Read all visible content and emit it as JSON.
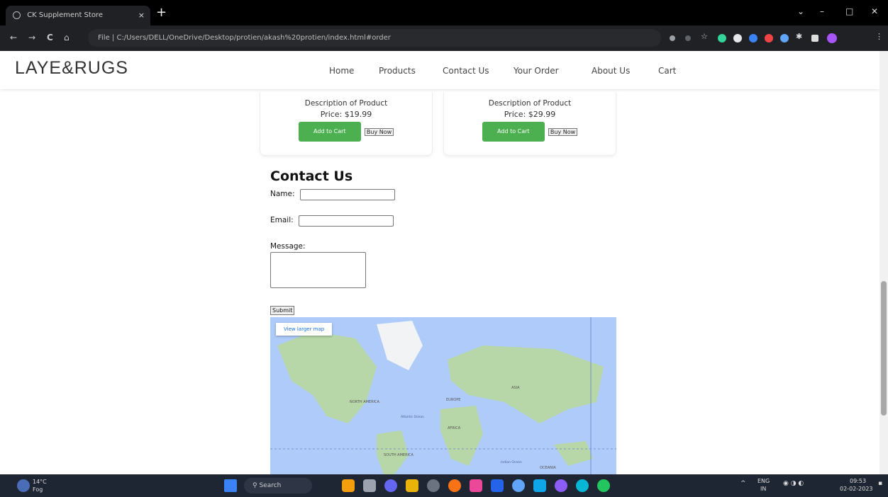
{
  "browser": {
    "tab_title": "CK Supplement Store",
    "tab_close": "×",
    "new_tab": "+",
    "address": "File | C:/Users/DELL/OneDrive/Desktop/protien/akash%20protien/index.html#order",
    "nav": {
      "back": "←",
      "forward": "→",
      "reload": "C",
      "home": "⌂"
    },
    "window": {
      "min": "–",
      "max": "□",
      "close": "✕"
    }
  },
  "site": {
    "logo": "LAYE&RUGS",
    "nav": [
      "Home",
      "Products",
      "Contact Us",
      "Your Order",
      "About Us",
      "Cart"
    ],
    "products": [
      {
        "description": "Description of Product",
        "price": "Price: $19.99",
        "add_label": "Add to Cart",
        "buy_label": "Buy Now"
      },
      {
        "description": "Description of Product",
        "price": "Price: $29.99",
        "add_label": "Add to Cart",
        "buy_label": "Buy Now"
      }
    ],
    "contact": {
      "title": "Contact Us",
      "name_label": "Name:",
      "email_label": "Email:",
      "message_label": "Message:",
      "submit_label": "Submit"
    },
    "map": {
      "larger_map": "View larger map",
      "labels": [
        "NORTH AMERICA",
        "EUROPE",
        "ASIA",
        "AFRICA",
        "SOUTH AMERICA",
        "Atlantic Ocean",
        "Indian Ocean",
        "OCEANIA"
      ]
    }
  },
  "taskbar": {
    "weather_temp": "14°C",
    "weather_desc": "Fog",
    "search": "Search",
    "lang": "ENG",
    "region": "IN",
    "time": "09:53",
    "date": "02-02-2023"
  },
  "colors": {
    "accent_green": "#4caf50",
    "map_water": "#aecbfa",
    "map_land": "#b7d7a8"
  }
}
